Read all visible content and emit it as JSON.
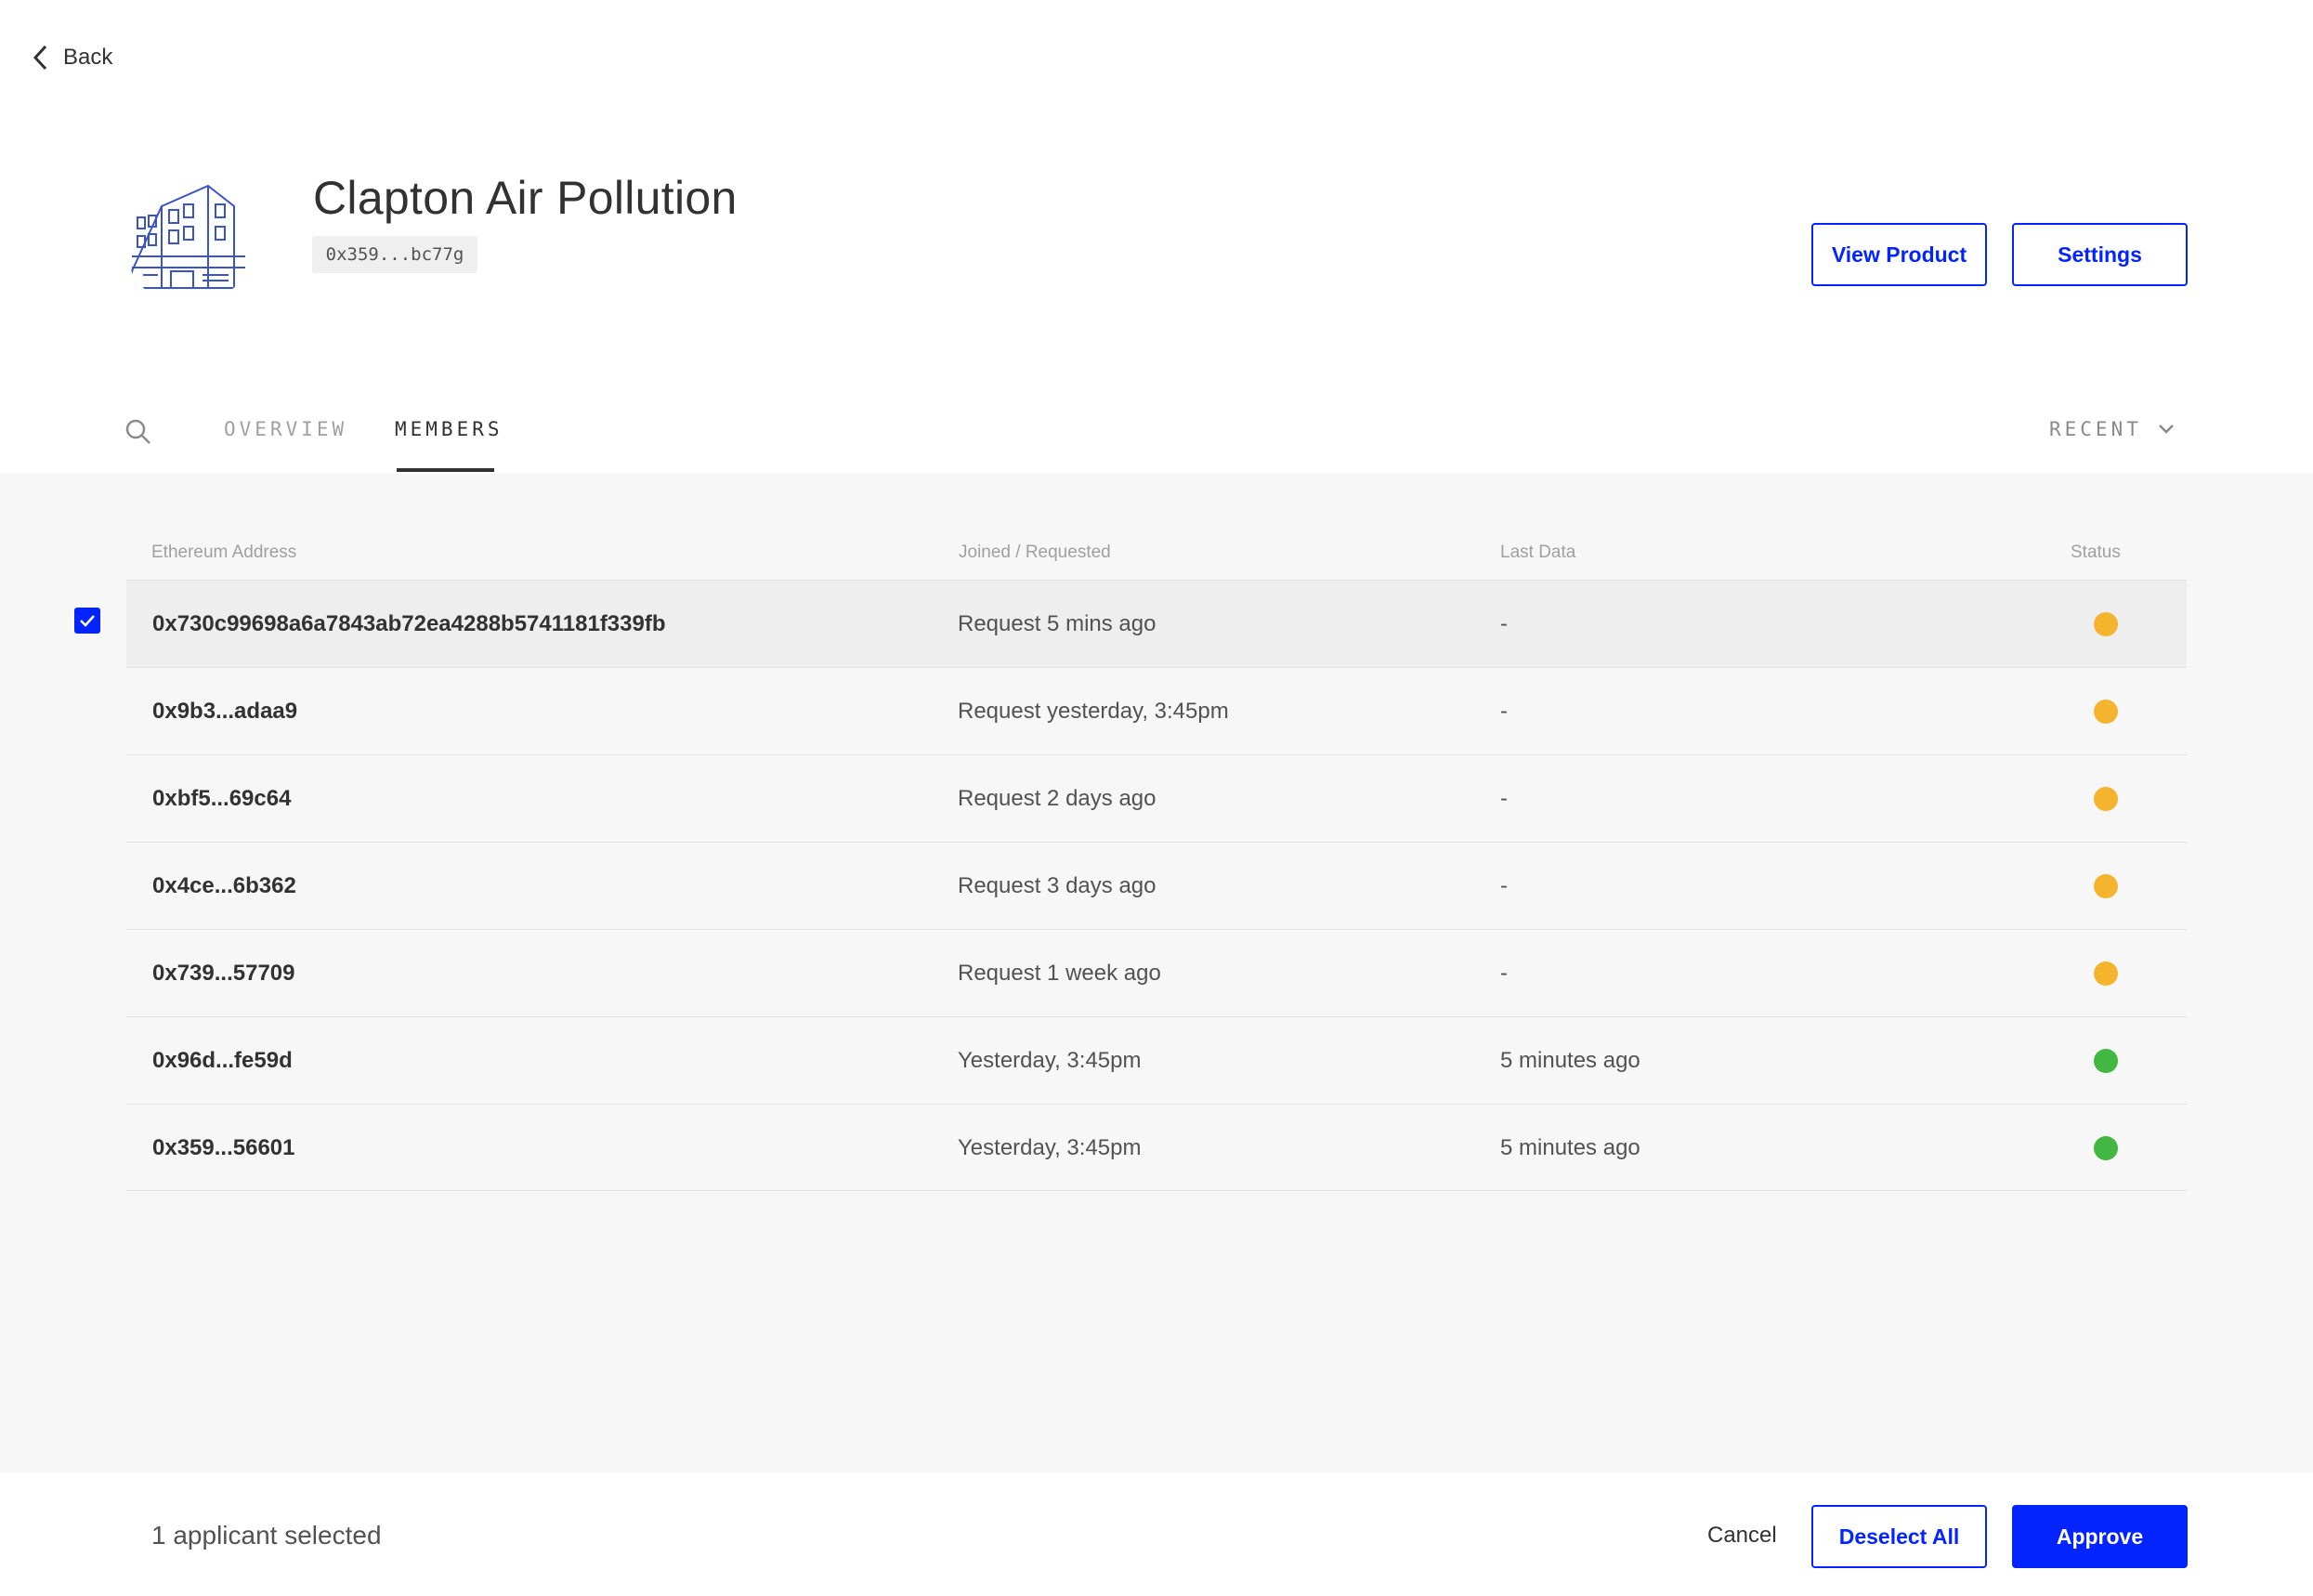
{
  "nav": {
    "back_label": "Back"
  },
  "product": {
    "title": "Clapton Air Pollution",
    "address": "0x359...bc77g"
  },
  "header_buttons": {
    "view_product": "View Product",
    "settings": "Settings"
  },
  "tabs": [
    {
      "label": "OVERVIEW",
      "active": false
    },
    {
      "label": "MEMBERS",
      "active": true
    }
  ],
  "sort": {
    "label": "RECENT"
  },
  "table": {
    "columns": {
      "address": "Ethereum Address",
      "joined": "Joined / Requested",
      "last_data": "Last Data",
      "status": "Status"
    },
    "rows": [
      {
        "address": "0x730c99698a6a7843ab72ea4288b5741181f339fb",
        "joined": "Request 5 mins ago",
        "last_data": "-",
        "status": "pending",
        "selected": true
      },
      {
        "address": "0x9b3...adaa9",
        "joined": "Request yesterday, 3:45pm",
        "last_data": "-",
        "status": "pending",
        "selected": false
      },
      {
        "address": "0xbf5...69c64",
        "joined": "Request 2 days ago",
        "last_data": "-",
        "status": "pending",
        "selected": false
      },
      {
        "address": "0x4ce...6b362",
        "joined": "Request 3 days ago",
        "last_data": "-",
        "status": "pending",
        "selected": false
      },
      {
        "address": "0x739...57709",
        "joined": "Request 1 week ago",
        "last_data": "-",
        "status": "pending",
        "selected": false
      },
      {
        "address": "0x96d...fe59d",
        "joined": "Yesterday, 3:45pm",
        "last_data": "5 minutes ago",
        "status": "active",
        "selected": false
      },
      {
        "address": "0x359...56601",
        "joined": "Yesterday, 3:45pm",
        "last_data": "5 minutes ago",
        "status": "active",
        "selected": false
      }
    ]
  },
  "status_colors": {
    "pending": "#f5b42e",
    "active": "#42b742"
  },
  "accent_color": "#0324ff",
  "footer": {
    "selected_count": "1",
    "selected_label": "applicant selected",
    "cancel": "Cancel",
    "deselect_all": "Deselect All",
    "approve": "Approve"
  }
}
